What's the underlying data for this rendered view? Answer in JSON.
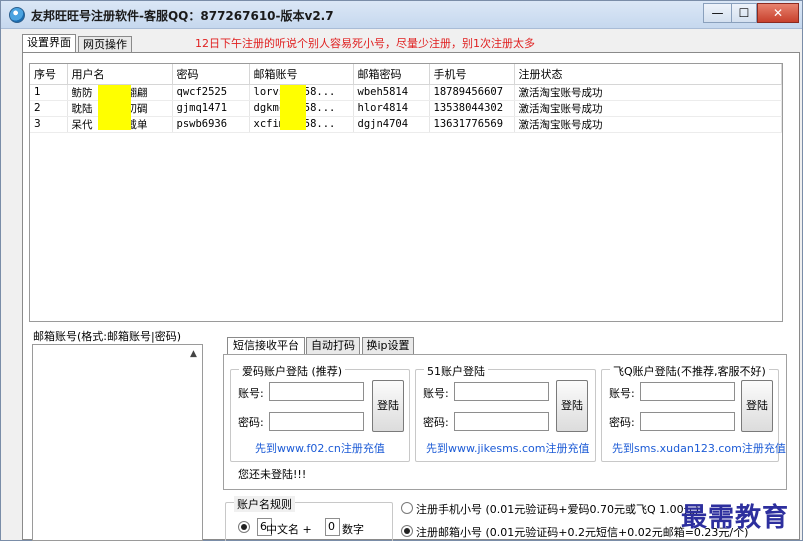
{
  "window": {
    "title": "友邦旺旺号注册软件-客服QQ：877267610-版本v2.7",
    "minimize_glyph": "—",
    "maximize_glyph": "☐",
    "close_glyph": "✕"
  },
  "tabs": [
    {
      "label": "设置界面",
      "active": true
    },
    {
      "label": "网页操作",
      "active": false
    }
  ],
  "notice": "12日下午注册的听说个别人容易死小号，尽量少注册，别1次注册太多",
  "table": {
    "columns": [
      "序号",
      "用户名",
      "密码",
      "邮箱账号",
      "邮箱密码",
      "手机号",
      "注册状态"
    ],
    "rows": [
      [
        "1",
        "鲂防",
        "翩翩",
        "qwcf2525",
        "lorvs",
        "3258...",
        "wbeh5814",
        "18789456607",
        "激活淘宝账号成功"
      ],
      [
        "2",
        "耽陆",
        "叨碉",
        "gjmq1471",
        "dgkmc",
        "3258...",
        "hlor4814",
        "13538044302",
        "激活淘宝账号成功"
      ],
      [
        "3",
        "呆代",
        "戴单",
        "pswb6936",
        "xcfim",
        "3158...",
        "dgjn4704",
        "13631776569",
        "激活淘宝账号成功"
      ]
    ]
  },
  "mail_list": {
    "title": "邮箱账号(格式:邮箱账号|密码)",
    "scroll_up_glyph": "▲"
  },
  "subtabs": [
    {
      "label": "短信接收平台",
      "active": true
    },
    {
      "label": "自动打码",
      "active": false
    },
    {
      "label": "换ip设置",
      "active": false
    }
  ],
  "sms_groups": [
    {
      "title": "爱码账户登陆 (推荐)",
      "account_label": "账号:",
      "password_label": "密码:",
      "login_button": "登陆",
      "link": "先到www.f02.cn注册充值"
    },
    {
      "title": "51账户登陆",
      "account_label": "账号:",
      "password_label": "密码:",
      "login_button": "登陆",
      "link": "先到www.jikesms.com注册充值"
    },
    {
      "title": "飞Q账户登陆(不推荐,客服不好)",
      "account_label": "账号:",
      "password_label": "密码:",
      "login_button": "登陆",
      "link": "先到sms.xudan123.com注册充值"
    }
  ],
  "login_status": "您还未登陆!!!",
  "account_rule": {
    "title": "账户名规则",
    "chinese_count": "6",
    "chinese_label": "中文名 +",
    "digit_count": "0",
    "digit_label": "数字"
  },
  "register_options": [
    {
      "label": "注册手机小号 (0.01元验证码+爱码0.70元或飞Q 1.00元)",
      "selected": false
    },
    {
      "label": "注册邮箱小号 (0.01元验证码+0.2元短信+0.02元邮箱=0.23元/个)",
      "selected": true
    }
  ],
  "watermark": "最需教育",
  "colors": {
    "notice_red": "#e02020",
    "link_blue": "#1c5bd6",
    "redaction_yellow": "#ffff00"
  }
}
